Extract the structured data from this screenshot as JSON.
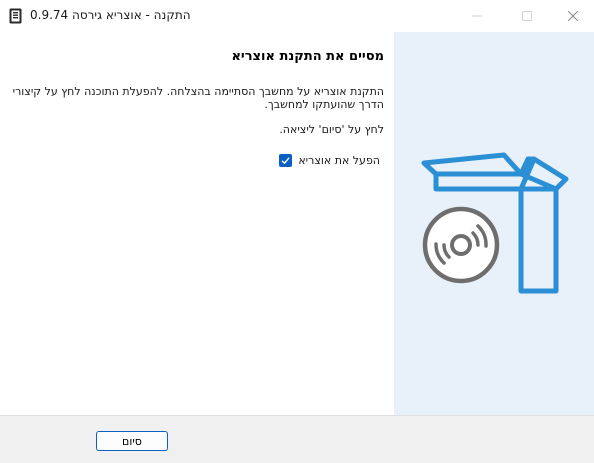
{
  "window": {
    "title": "התקנה - אוצריא גירסה 0.9.74"
  },
  "page": {
    "heading": "מסיים את התקנת אוצריא",
    "description": "התקנת אוצריא על מחשבך הסתיימה בהצלחה. להפעלת התוכנה לחץ על קיצורי הדרך שהועתקו למחשבך.",
    "exit_hint": "לחץ על 'סיום' ליציאה.",
    "launch_checkbox": {
      "label": "הפעל את אוצריא",
      "checked": true
    }
  },
  "footer": {
    "finish_label": "סיום"
  },
  "colors": {
    "accent": "#0a5fc2",
    "art_blue": "#2b8fd6",
    "side_panel": "#e8f1f9"
  },
  "icons": [
    "installer-app-icon",
    "minimize-icon",
    "maximize-icon",
    "close-icon",
    "checkmark-icon",
    "installer-box-icon",
    "disc-icon"
  ]
}
